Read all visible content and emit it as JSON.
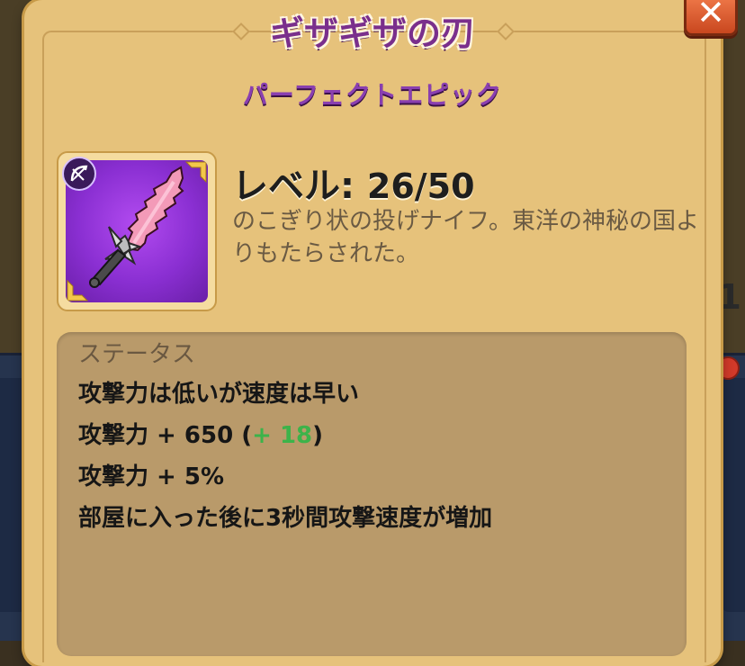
{
  "item": {
    "name": "ギザギザの刃",
    "rarity": "パーフェクトエピック",
    "level_label": "レベル: ",
    "level_value": "26/50",
    "description": "のこぎり状の投げナイフ。東洋の神秘の国よりもたらされた。"
  },
  "stats": {
    "header": "ステータス",
    "lines": [
      {
        "text": "攻撃力は低いが速度は早い"
      },
      {
        "prefix": "攻撃力 + 650 (",
        "bonus": "+ 18",
        "suffix": ")"
      },
      {
        "text": "攻撃力 + 5%"
      },
      {
        "text": "部屋に入った後に3秒間攻撃速度が増加"
      }
    ]
  },
  "close_button": {
    "label": "✕",
    "icon": "close-icon"
  },
  "background": {
    "partial_digit": "1"
  },
  "colors": {
    "panel": "#e6c27b",
    "title": "#7a2f8c",
    "rarity": "#8a3fb0",
    "item_bg": "#8a2fd2",
    "bonus_green": "#3cb34a",
    "close_button": "#e0602f"
  }
}
